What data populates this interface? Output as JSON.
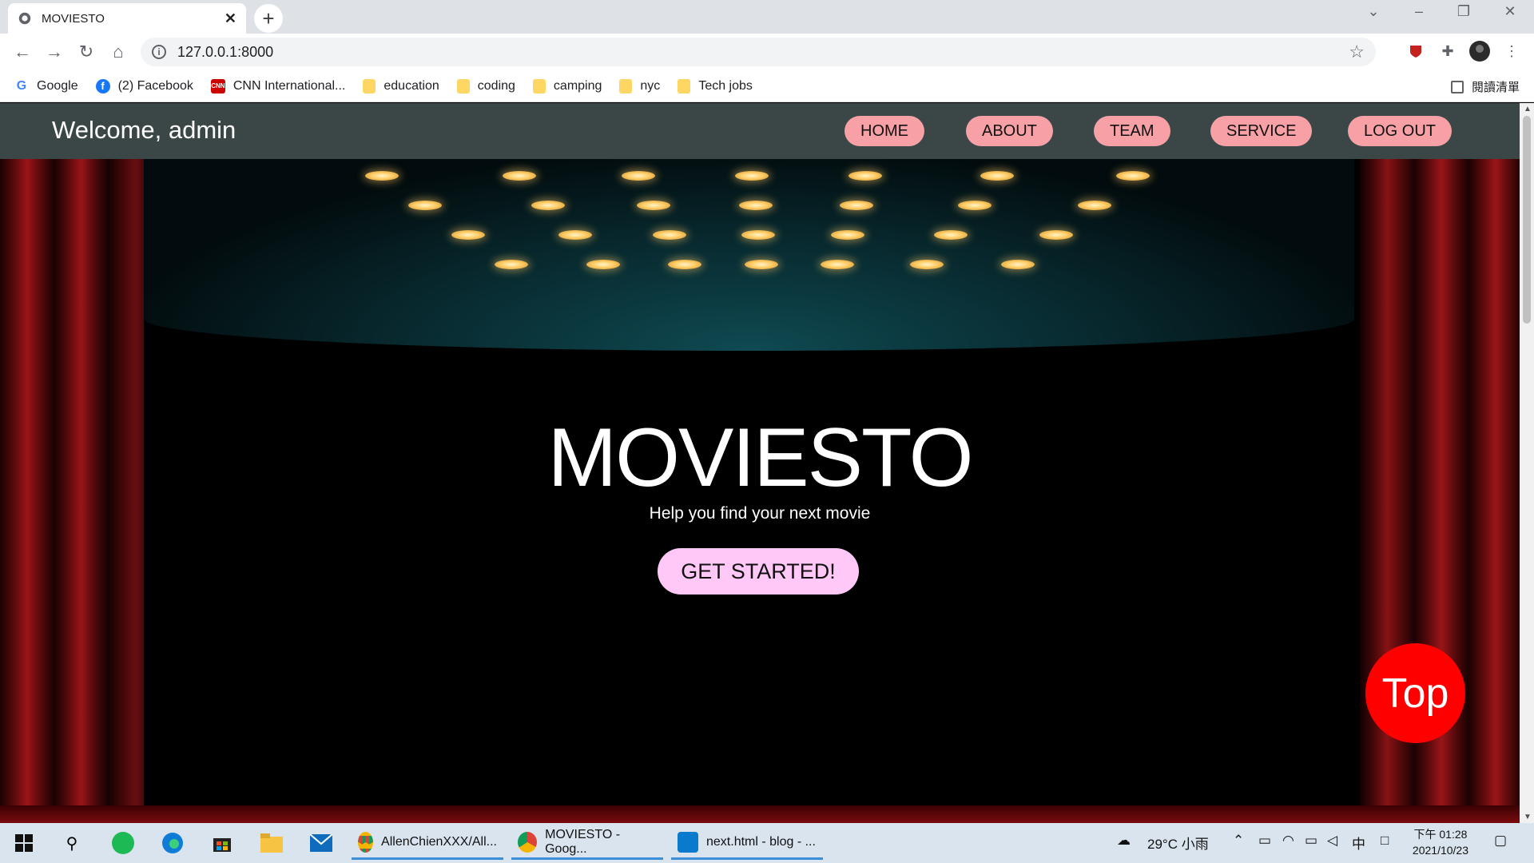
{
  "browser": {
    "tab_title": "MOVIESTO",
    "tab_close": "✕",
    "new_tab": "+",
    "url": "127.0.0.1:8000",
    "bookmarks": [
      {
        "label": "Google",
        "icon": "google-icon"
      },
      {
        "label": "(2) Facebook",
        "icon": "facebook-icon"
      },
      {
        "label": "CNN International...",
        "icon": "cnn-icon"
      },
      {
        "label": "education",
        "icon": "folder-icon"
      },
      {
        "label": "coding",
        "icon": "folder-icon"
      },
      {
        "label": "camping",
        "icon": "folder-icon"
      },
      {
        "label": "nyc",
        "icon": "folder-icon"
      },
      {
        "label": "Tech jobs",
        "icon": "folder-icon"
      }
    ],
    "reading_list": "閱讀清單"
  },
  "page": {
    "welcome": "Welcome, admin",
    "nav": [
      "HOME",
      "ABOUT",
      "TEAM",
      "SERVICE",
      "LOG OUT"
    ],
    "hero_title": "MOVIESTO",
    "hero_subtitle": "Help you find your next movie",
    "cta_label": "GET STARTED!",
    "top_label": "Top",
    "colors": {
      "navbar": "#3b4747",
      "nav_button": "#f7a0a6",
      "cta": "#ffc8f7",
      "top_button": "#ff0000"
    }
  },
  "taskbar": {
    "apps": [
      {
        "label": "AllenChienXXX/All...",
        "icon": "chrome-icon"
      },
      {
        "label": "MOVIESTO - Goog...",
        "icon": "chrome-icon"
      },
      {
        "label": "next.html - blog - ...",
        "icon": "vscode-icon"
      }
    ],
    "weather": "29°C 小雨",
    "ime": "中",
    "time": "下午 01:28",
    "date": "2021/10/23"
  }
}
